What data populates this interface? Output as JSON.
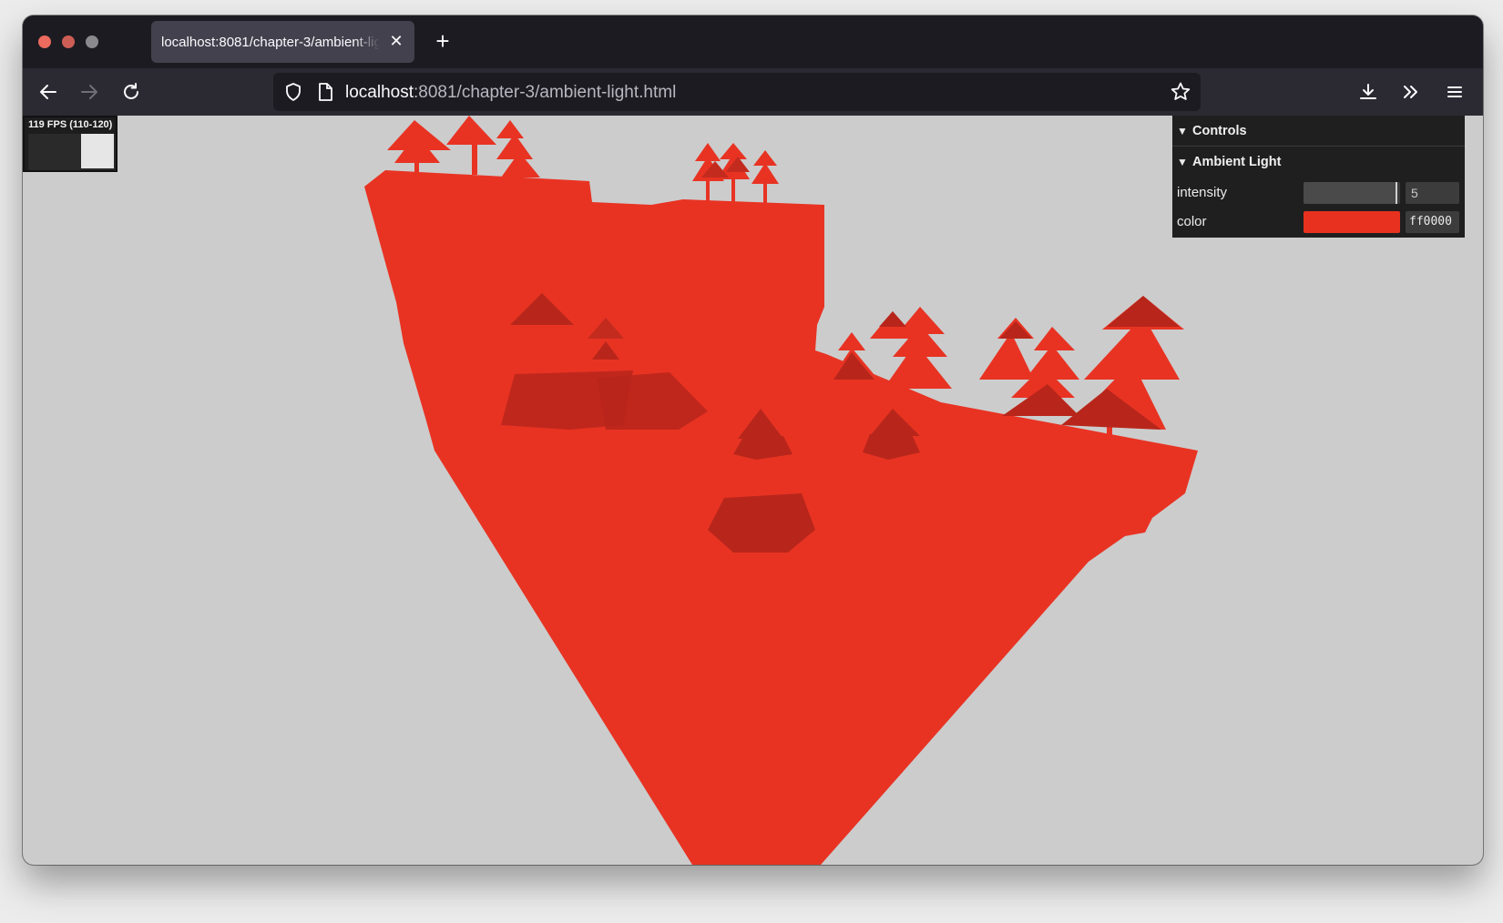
{
  "browser": {
    "tab_title": "localhost:8081/chapter-3/ambient-light.html",
    "url_host": "localhost",
    "url_rest": ":8081/chapter-3/ambient-light.html"
  },
  "stats": {
    "fps_text": "119 FPS (110-120)"
  },
  "gui": {
    "root_title": "Controls",
    "folder_title": "Ambient Light",
    "intensity": {
      "label": "intensity",
      "value": "5",
      "slider_fraction": 0.97
    },
    "color": {
      "label": "color",
      "value": "ff0000",
      "swatch": "#e8321f"
    }
  },
  "colors": {
    "scene_background": "#cccccc",
    "terrain": "#e83323",
    "shadow": "#b8261b"
  }
}
